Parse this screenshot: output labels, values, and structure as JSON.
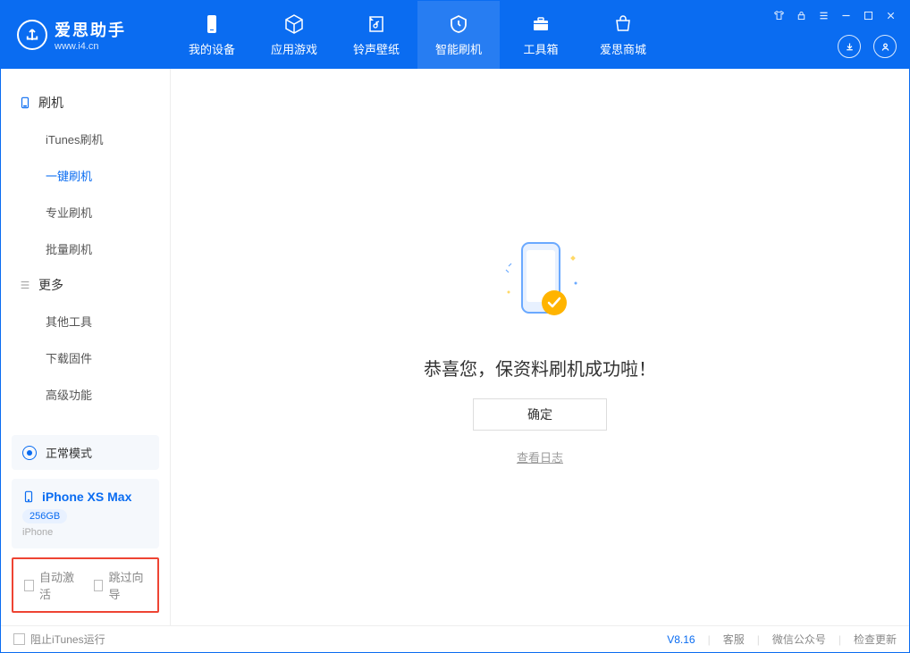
{
  "app": {
    "title": "爱思助手",
    "subtitle": "www.i4.cn"
  },
  "nav": {
    "items": [
      {
        "label": "我的设备"
      },
      {
        "label": "应用游戏"
      },
      {
        "label": "铃声壁纸"
      },
      {
        "label": "智能刷机"
      },
      {
        "label": "工具箱"
      },
      {
        "label": "爱思商城"
      }
    ]
  },
  "sidebar": {
    "group1": {
      "title": "刷机",
      "items": [
        "iTunes刷机",
        "一键刷机",
        "专业刷机",
        "批量刷机"
      ]
    },
    "group2": {
      "title": "更多",
      "items": [
        "其他工具",
        "下载固件",
        "高级功能"
      ]
    },
    "mode": "正常模式",
    "device": {
      "name": "iPhone XS Max",
      "capacity": "256GB",
      "model": "iPhone"
    },
    "checks": {
      "auto_activate": "自动激活",
      "skip_guide": "跳过向导"
    }
  },
  "main": {
    "success_msg": "恭喜您，保资料刷机成功啦！",
    "ok_label": "确定",
    "log_link": "查看日志"
  },
  "footer": {
    "block_itunes": "阻止iTunes运行",
    "version": "V8.16",
    "links": [
      "客服",
      "微信公众号",
      "检查更新"
    ]
  }
}
